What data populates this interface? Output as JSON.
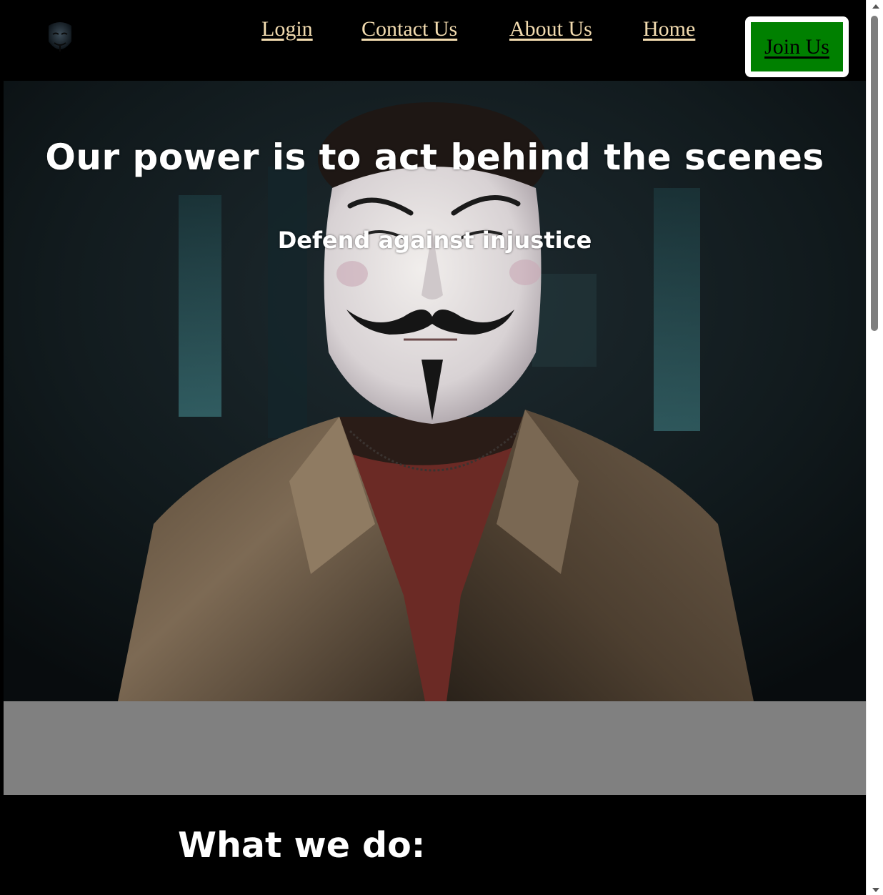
{
  "nav": {
    "logo_alt": "anonymous-mask-logo",
    "links": [
      {
        "label": "Login"
      },
      {
        "label": "Contact Us"
      },
      {
        "label": "About Us"
      },
      {
        "label": "Home"
      }
    ],
    "join_label": "Join Us"
  },
  "hero": {
    "title": "Our power is to act behind the scenes",
    "subtitle": "Defend against injustice",
    "image_subject": "person-wearing-guy-fawkes-mask"
  },
  "section": {
    "title": "What we do:"
  },
  "colors": {
    "nav_link": "#f3dcb0",
    "join_button_bg": "#008000",
    "band_gray": "#808080",
    "background": "#000000"
  },
  "scrollbar": {
    "position_fraction": 0.0
  }
}
